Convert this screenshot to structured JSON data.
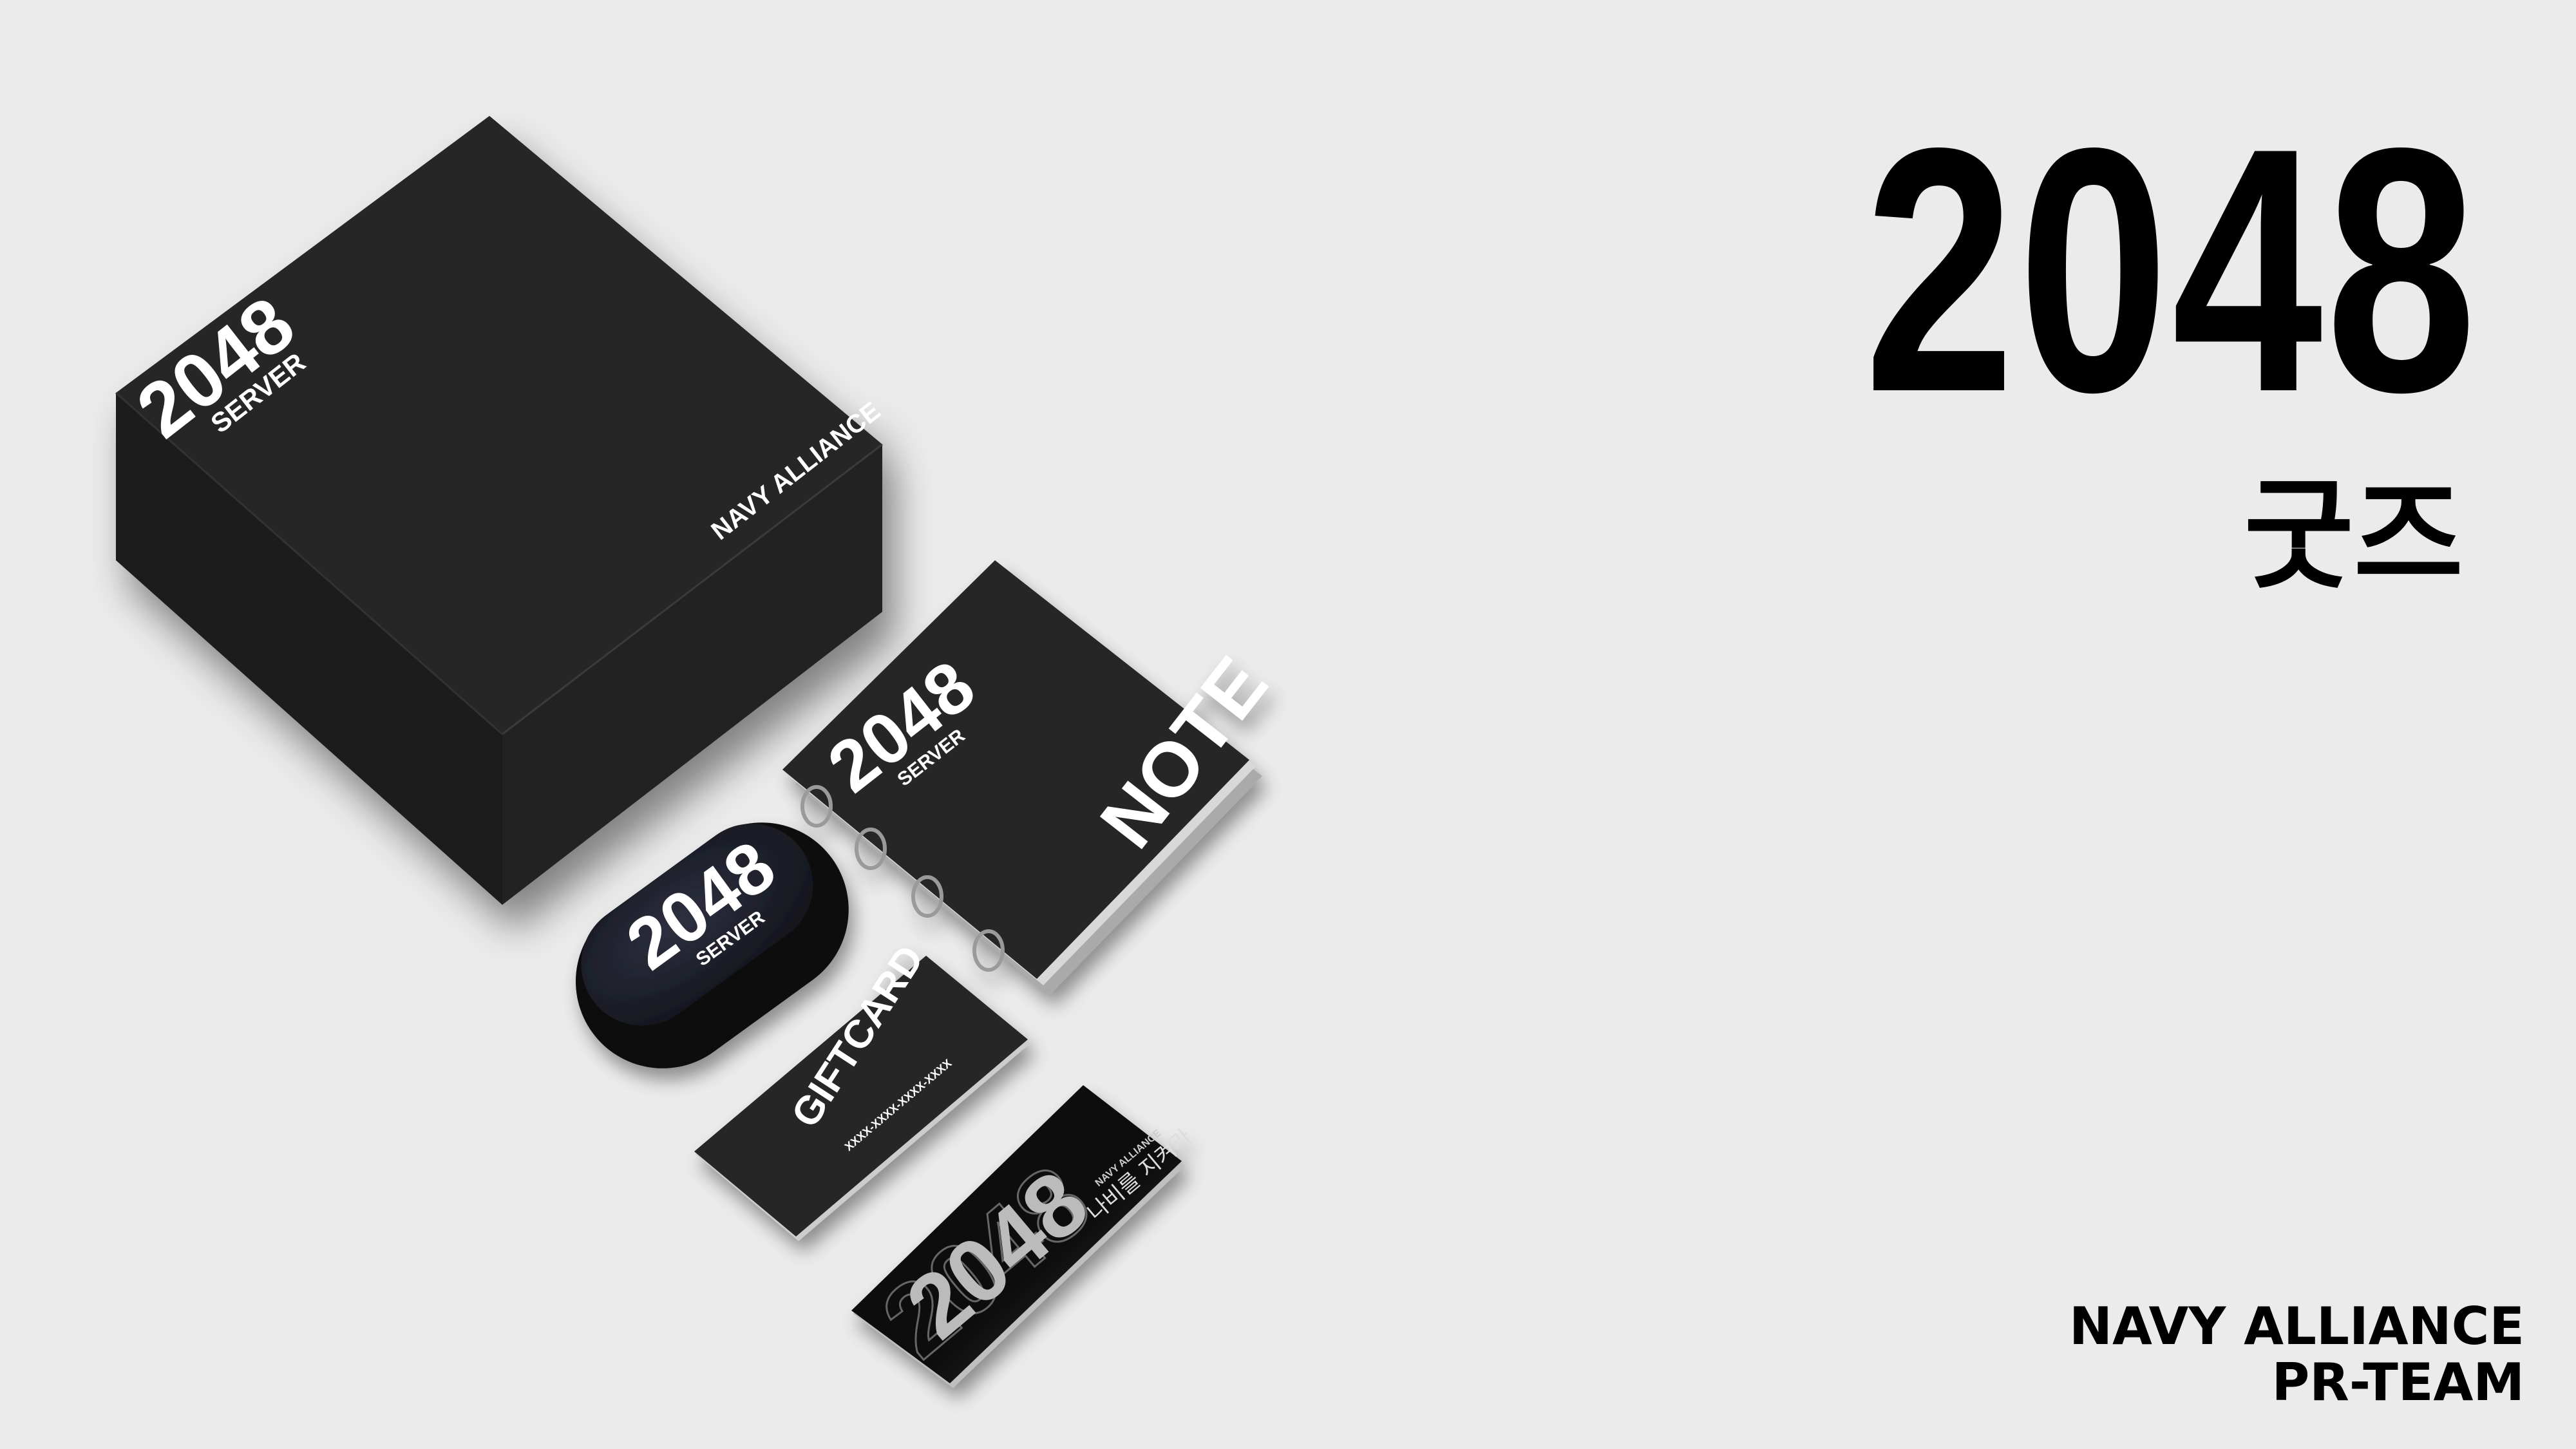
{
  "hero": {
    "title": "2048",
    "subtitle": "굿즈"
  },
  "footer": {
    "line1": "NAVY ALLIANCE",
    "line2": "PR-TEAM"
  },
  "products": {
    "box": {
      "logo": "2048",
      "logo_sub": "SERVER",
      "side_text": "NAVY ALLIANCE"
    },
    "note": {
      "logo": "2048",
      "logo_sub": "SERVER",
      "label": "NOTE"
    },
    "earbuds_case": {
      "logo": "2048",
      "logo_sub": "SERVER"
    },
    "gift_card": {
      "label": "GIFTCARD",
      "code": "XXXX-XXXX-XXXX-XXXX"
    },
    "ticket": {
      "logo": "2048",
      "brand": "NAVY ALLIANCE",
      "tagline": "나비를 지켜라"
    }
  },
  "colors": {
    "background": "#ebebeb",
    "product_dark": "#222222",
    "text_dark": "#000000",
    "text_light": "#ffffff"
  }
}
